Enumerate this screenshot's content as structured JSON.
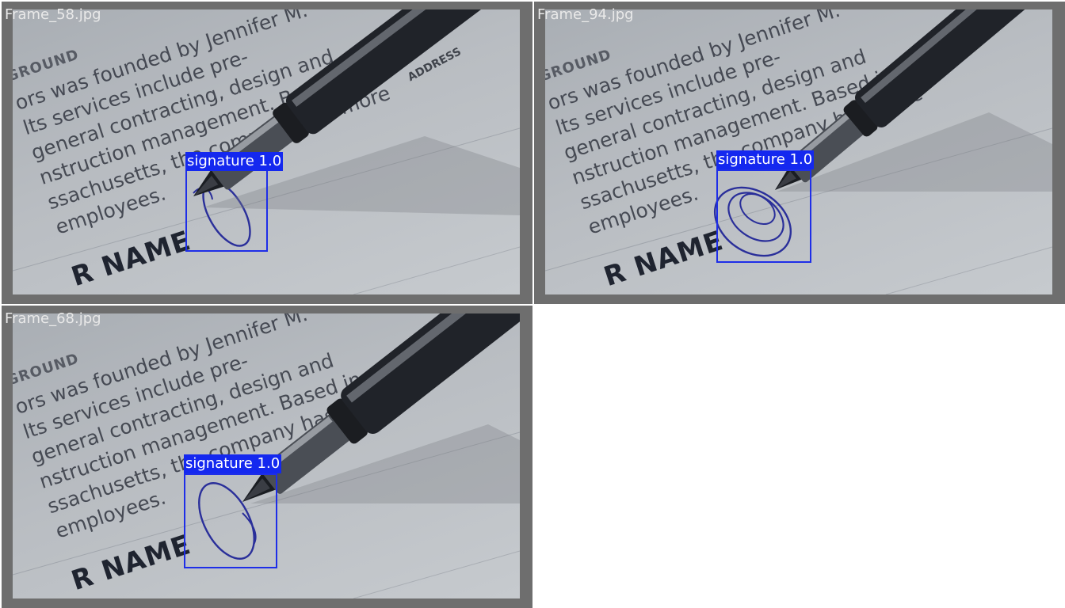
{
  "tiles": [
    {
      "filename": "Frame_58.jpg",
      "detections": [
        {
          "class_name": "signature",
          "confidence": "1.0"
        }
      ],
      "document_text": {
        "heading": "GROUND",
        "lines": [
          "ors was founded by Jennifer M.",
          "lts services include pre-",
          "general contracting, design and",
          "nstruction management. Based in",
          "ssachusetts, the company has more",
          "employees."
        ],
        "name_field": "R NAME",
        "address_label": "ADDRESS"
      }
    },
    {
      "filename": "Frame_94.jpg",
      "detections": [
        {
          "class_name": "signature",
          "confidence": "1.0"
        }
      ],
      "document_text": {
        "heading": "GROUND",
        "lines": [
          "ors was founded by Jennifer M.",
          "lts services include pre-",
          "general contracting, design and",
          "nstruction management. Based in",
          "ssachusetts, the company has more",
          "employees."
        ],
        "name_field": "R NAME",
        "address_label": ""
      }
    },
    {
      "filename": "Frame_68.jpg",
      "detections": [
        {
          "class_name": "signature",
          "confidence": "1.0"
        }
      ],
      "document_text": {
        "heading": "GROUND",
        "lines": [
          "ors was founded by Jennifer M.",
          "lts services include pre-",
          "general contracting, design and",
          "nstruction management. Based in",
          "ssachusetts, the company has more",
          "employees."
        ],
        "name_field": "R NAME",
        "address_label": ""
      }
    }
  ],
  "colors": {
    "tile_frame": "#6e6e6e",
    "detection_box": "#1e2ee8",
    "detection_label_bg": "#1428ef",
    "signature_ink": "#2a2f9a"
  }
}
